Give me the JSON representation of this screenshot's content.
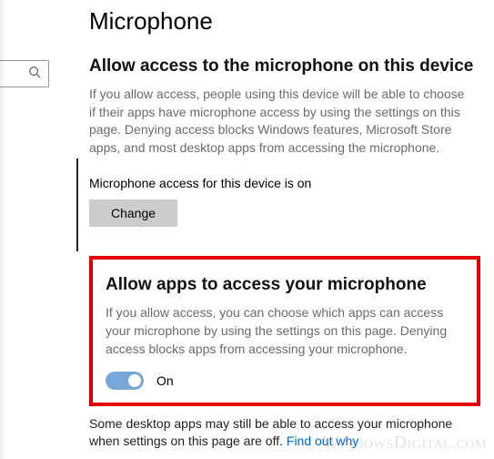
{
  "page": {
    "title": "Microphone"
  },
  "section1": {
    "heading": "Allow access to the microphone on this device",
    "body": "If you allow access, people using this device will be able to choose if their apps have microphone access by using the settings on this page. Denying access blocks Windows features, Microsoft Store apps, and most desktop apps from accessing the microphone.",
    "status": "Microphone access for this device is on",
    "change_button": "Change"
  },
  "section2": {
    "heading": "Allow apps to access your microphone",
    "body": "If you allow access, you can choose which apps can access your microphone by using the settings on this page. Denying access blocks apps from accessing your microphone.",
    "toggle_state": "On"
  },
  "footer": {
    "text_before": "Some desktop apps may still be able to access your microphone when settings on this page are off. ",
    "link": "Find out why"
  },
  "watermark": "WindowsDigital.com"
}
